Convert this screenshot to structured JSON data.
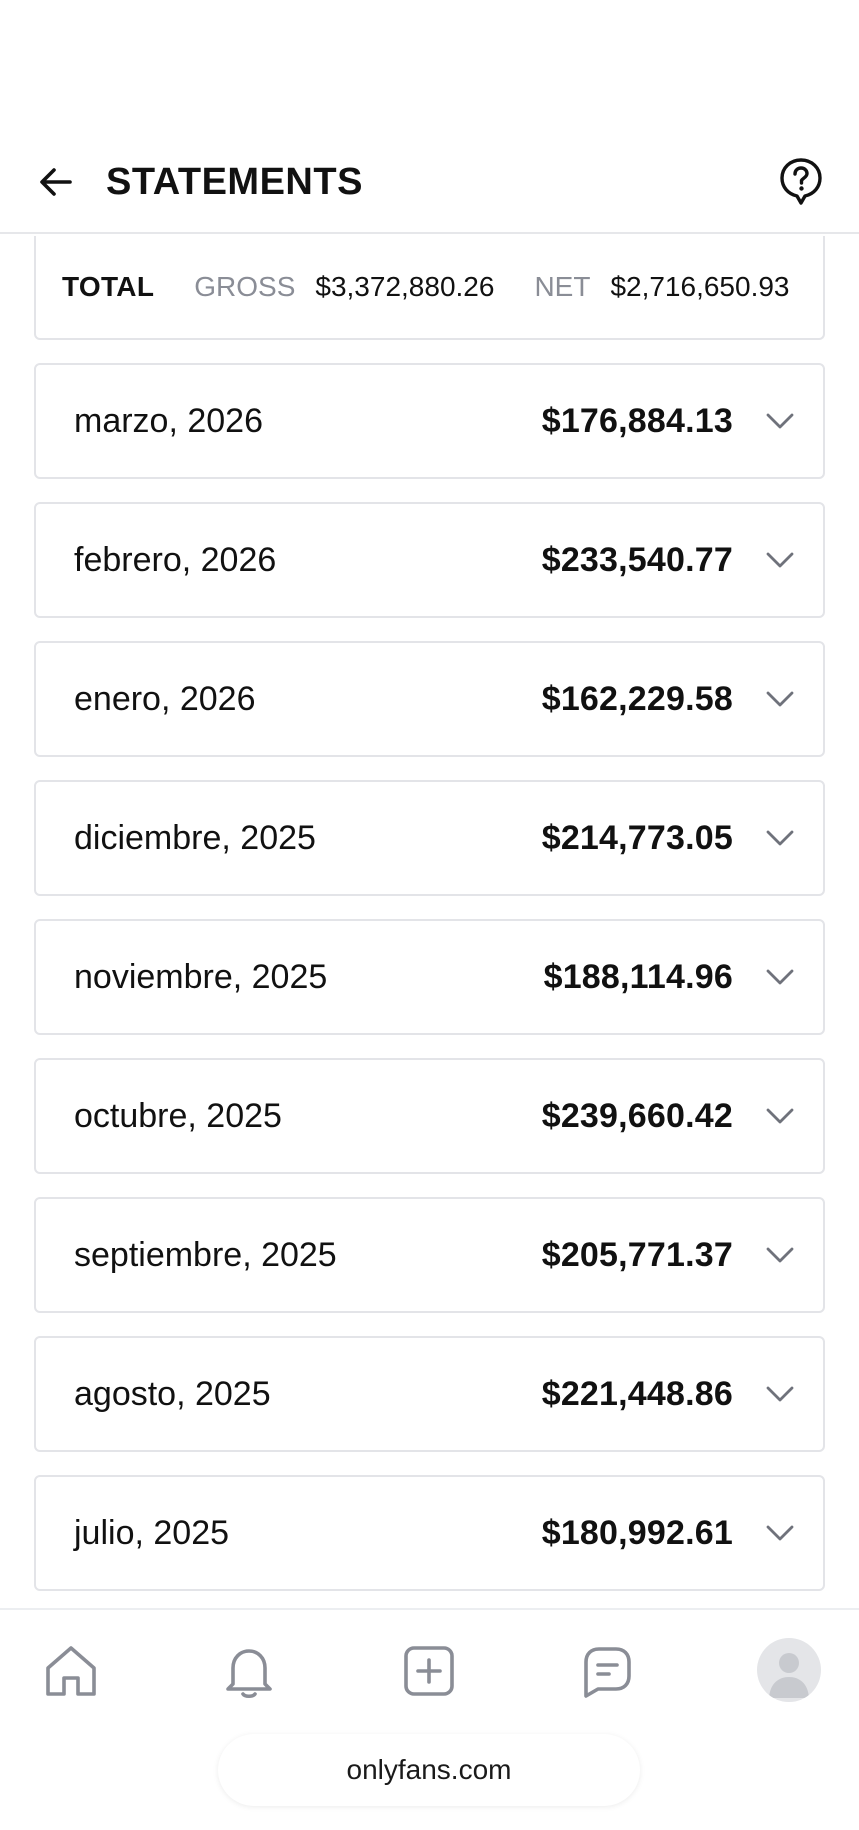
{
  "header": {
    "title": "STATEMENTS",
    "back_icon": "arrow-left-icon",
    "help_icon": "question-bubble-icon"
  },
  "totals": {
    "label": "TOTAL",
    "gross_label": "GROSS",
    "gross_value": "$3,372,880.26",
    "net_label": "NET",
    "net_value": "$2,716,650.93"
  },
  "statements": [
    {
      "month": "marzo, 2026",
      "amount": "$176,884.13"
    },
    {
      "month": "febrero, 2026",
      "amount": "$233,540.77"
    },
    {
      "month": "enero, 2026",
      "amount": "$162,229.58"
    },
    {
      "month": "diciembre, 2025",
      "amount": "$214,773.05"
    },
    {
      "month": "noviembre, 2025",
      "amount": "$188,114.96"
    },
    {
      "month": "octubre, 2025",
      "amount": "$239,660.42"
    },
    {
      "month": "septiembre, 2025",
      "amount": "$205,771.37"
    },
    {
      "month": "agosto, 2025",
      "amount": "$221,448.86"
    },
    {
      "month": "julio, 2025",
      "amount": "$180,992.61"
    }
  ],
  "bottom_nav": {
    "items": [
      "home-icon",
      "bell-icon",
      "plus-square-icon",
      "message-icon",
      "avatar"
    ]
  },
  "browser": {
    "url": "onlyfans.com"
  },
  "colors": {
    "icon": "#8a8d96",
    "border": "#e3e4e8",
    "text": "#111111",
    "muted": "#8a8d96"
  }
}
